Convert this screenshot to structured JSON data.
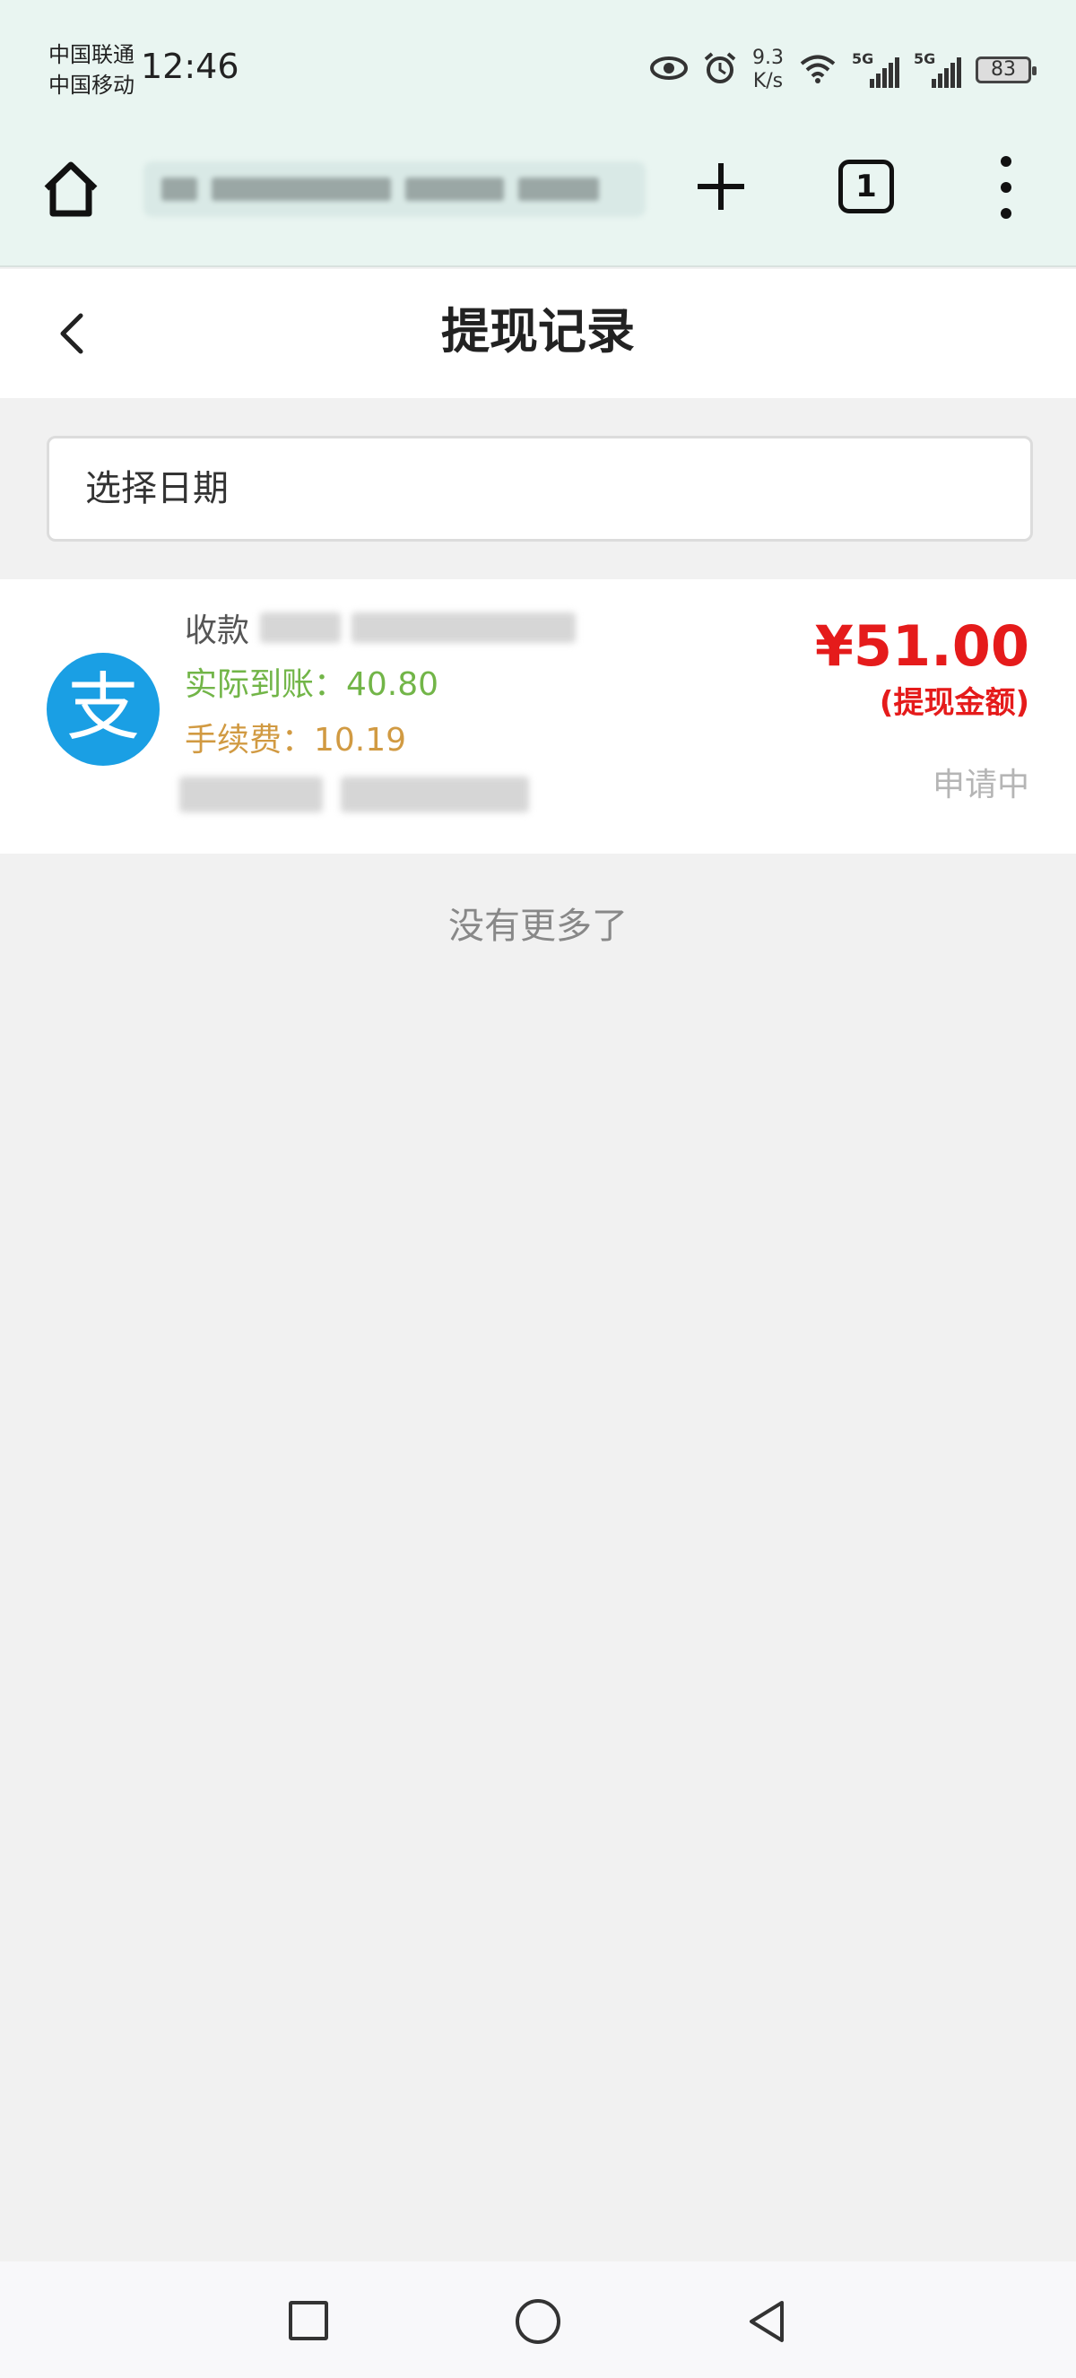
{
  "status_bar": {
    "carrier_1": "中国联通",
    "carrier_2": "中国移动",
    "time": "12:46",
    "net_speed_value": "9.3",
    "net_speed_unit": "K/s",
    "signal_1_label": "5G",
    "signal_2_label": "5G",
    "battery": "83",
    "icons": [
      "eye-icon",
      "alarm-icon",
      "wifi-icon",
      "signal-icon",
      "battery-icon"
    ]
  },
  "browser": {
    "tab_count": "1",
    "icons": [
      "home-icon",
      "plus-icon",
      "tabs-icon",
      "more-menu-icon"
    ]
  },
  "header": {
    "title": "提现记录",
    "back_icon": "chevron-left-icon"
  },
  "filter": {
    "date_placeholder": "选择日期"
  },
  "records": [
    {
      "icon": "alipay-icon",
      "icon_glyph": "支",
      "payee_label": "收款",
      "actual_label": "实际到账：40.80",
      "fee_label": "手续费：10.19",
      "amount": "¥51.00",
      "amount_caption": "(提现金额)",
      "status": "申请中"
    }
  ],
  "footer": {
    "no_more": "没有更多了"
  },
  "colors": {
    "amount": "#e51b1b",
    "actual": "#72b548",
    "fee": "#d19a42",
    "alipay_blue": "#1a9fe4",
    "browser_bg": "#e9f5f1"
  }
}
